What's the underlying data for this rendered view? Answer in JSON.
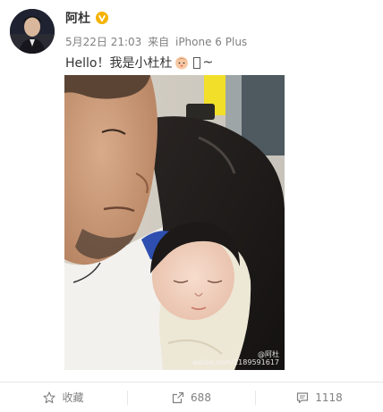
{
  "post": {
    "username": "阿杜",
    "timestamp": "5月22日 21:03",
    "source_prefix": "来自",
    "source_device": "iPhone 6 Plus",
    "text_before": "Hello！我是小杜杜",
    "text_after": "~",
    "image_watermark_line1": "@阿杜",
    "image_watermark_line2": "weibo.com/1189591617"
  },
  "actions": {
    "favorite_label": "收藏",
    "repost_count": "688",
    "comment_count": "1118"
  },
  "colors": {
    "verified_badge": "#f6b200",
    "meta_text": "#808080",
    "divider": "#e6e6e6"
  }
}
